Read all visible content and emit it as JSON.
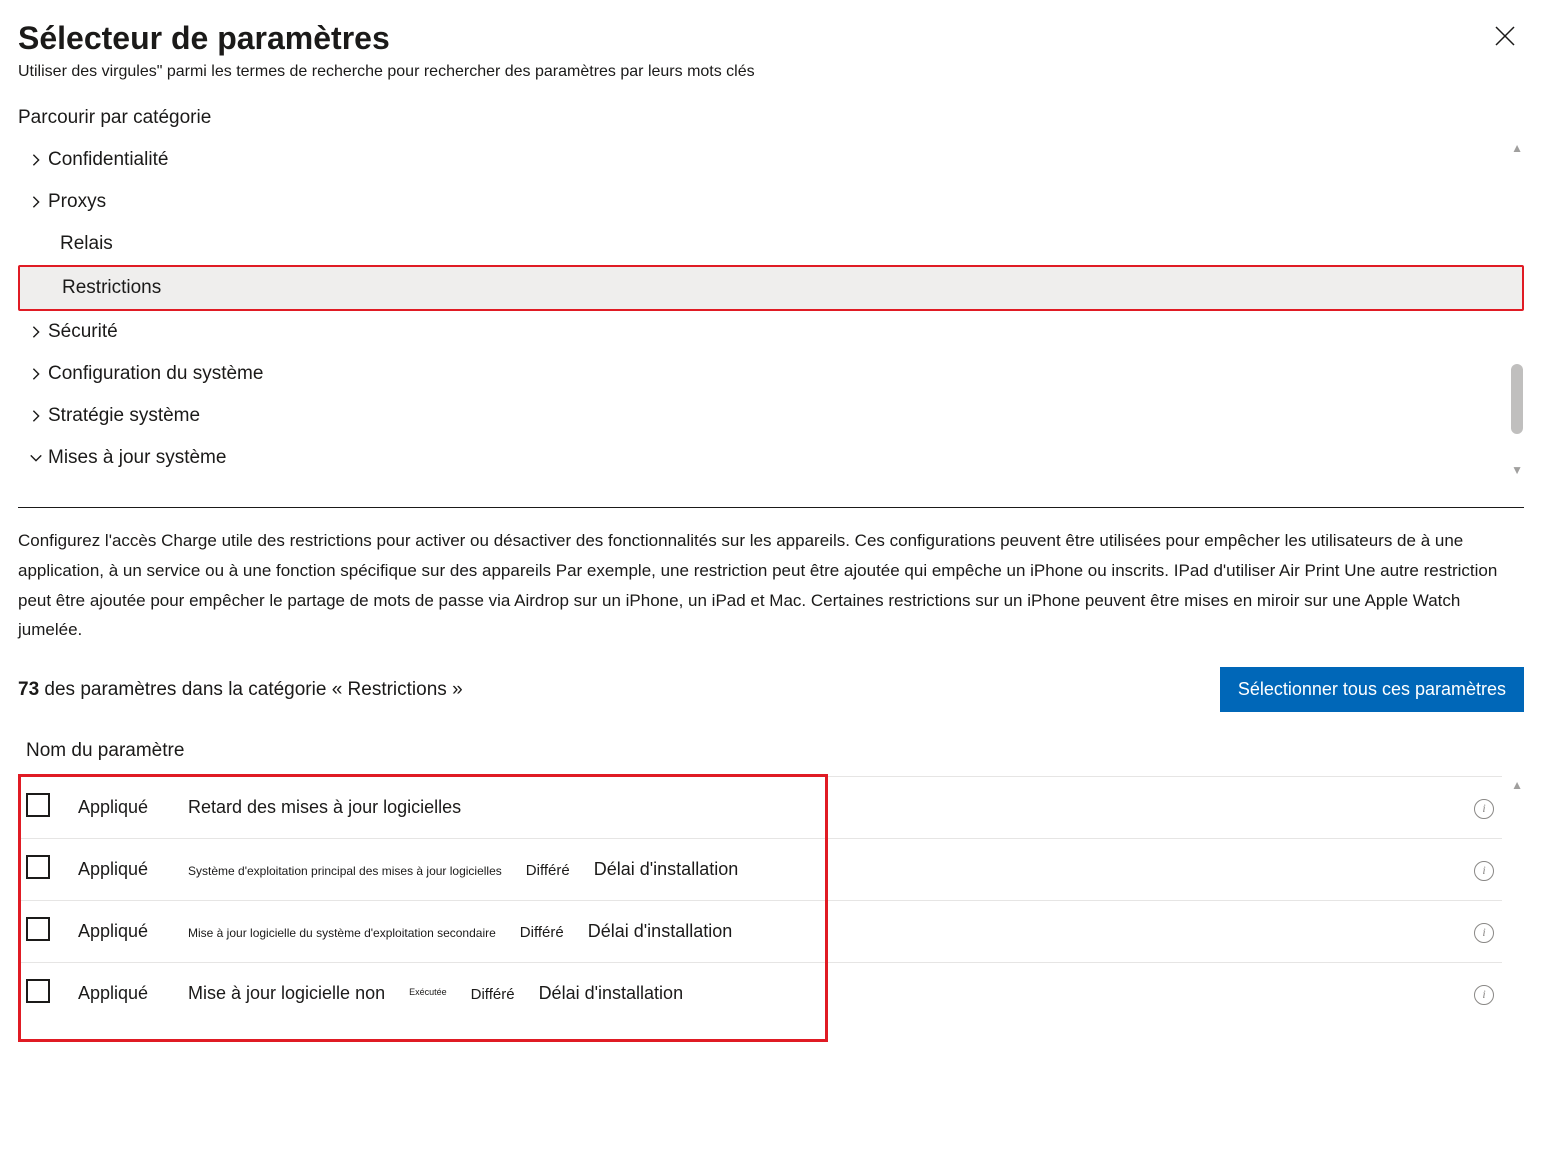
{
  "header": {
    "title": "Sélecteur de paramètres",
    "subtitle": "Utiliser des virgules\" parmi les termes de recherche pour rechercher des paramètres par leurs mots clés"
  },
  "browse_label": "Parcourir par catégorie",
  "tree": [
    {
      "label": "Confidentialité",
      "expandable": true,
      "expanded": false,
      "indent": false,
      "selected": false
    },
    {
      "label": "Proxys",
      "expandable": true,
      "expanded": false,
      "indent": false,
      "selected": false
    },
    {
      "label": "Relais",
      "expandable": false,
      "expanded": false,
      "indent": true,
      "selected": false
    },
    {
      "label": "Restrictions",
      "expandable": false,
      "expanded": false,
      "indent": true,
      "selected": true
    },
    {
      "label": "Sécurité",
      "expandable": true,
      "expanded": false,
      "indent": false,
      "selected": false
    },
    {
      "label": "Configuration du système",
      "expandable": true,
      "expanded": false,
      "indent": false,
      "selected": false
    },
    {
      "label": "Stratégie système",
      "expandable": true,
      "expanded": false,
      "indent": false,
      "selected": false
    },
    {
      "label": "Mises à jour système",
      "expandable": true,
      "expanded": true,
      "indent": false,
      "selected": false
    }
  ],
  "description": "Configurez l'accès   Charge utile des restrictions pour activer ou désactiver des fonctionnalités sur les appareils. Ces configurations peuvent être utilisées pour empêcher les utilisateurs de à une application, à un service ou à une fonction spécifique sur des appareils       Par exemple, une restriction peut être ajoutée qui empêche un iPhone ou inscrits. IPad d'utiliser Air Print Une autre restriction peut être ajoutée pour empêcher le partage de mots de passe via Airdrop sur un iPhone, un iPad et     Mac. Certaines restrictions sur un iPhone peuvent être mises en miroir sur une Apple Watch jumelée.",
  "count": {
    "number": "73",
    "text": "des paramètres dans la catégorie « Restrictions »"
  },
  "select_all": "Sélectionner tous ces paramètres",
  "column_header": "Nom du paramètre",
  "rows": [
    {
      "applied": "Appliqué",
      "parts": [
        {
          "text": "Retard des mises à jour logicielles",
          "size": "lg"
        }
      ]
    },
    {
      "applied": "Appliqué",
      "parts": [
        {
          "text": "Système d'exploitation principal des mises à jour logicielles",
          "size": "sm"
        },
        {
          "text": "Différé",
          "size": "md"
        },
        {
          "text": "Délai d'installation",
          "size": "lg"
        }
      ]
    },
    {
      "applied": "Appliqué",
      "parts": [
        {
          "text": "Mise à jour logicielle du système d'exploitation secondaire",
          "size": "sm"
        },
        {
          "text": "Différé",
          "size": "md"
        },
        {
          "text": "Délai d'installation",
          "size": "lg"
        }
      ]
    },
    {
      "applied": "Appliqué",
      "parts": [
        {
          "text": "Mise à jour logicielle non",
          "size": "lg"
        },
        {
          "text": "Exécutée",
          "size": "xs"
        },
        {
          "text": "Différé",
          "size": "md"
        },
        {
          "text": "Délai d'installation",
          "size": "lg"
        }
      ]
    }
  ]
}
